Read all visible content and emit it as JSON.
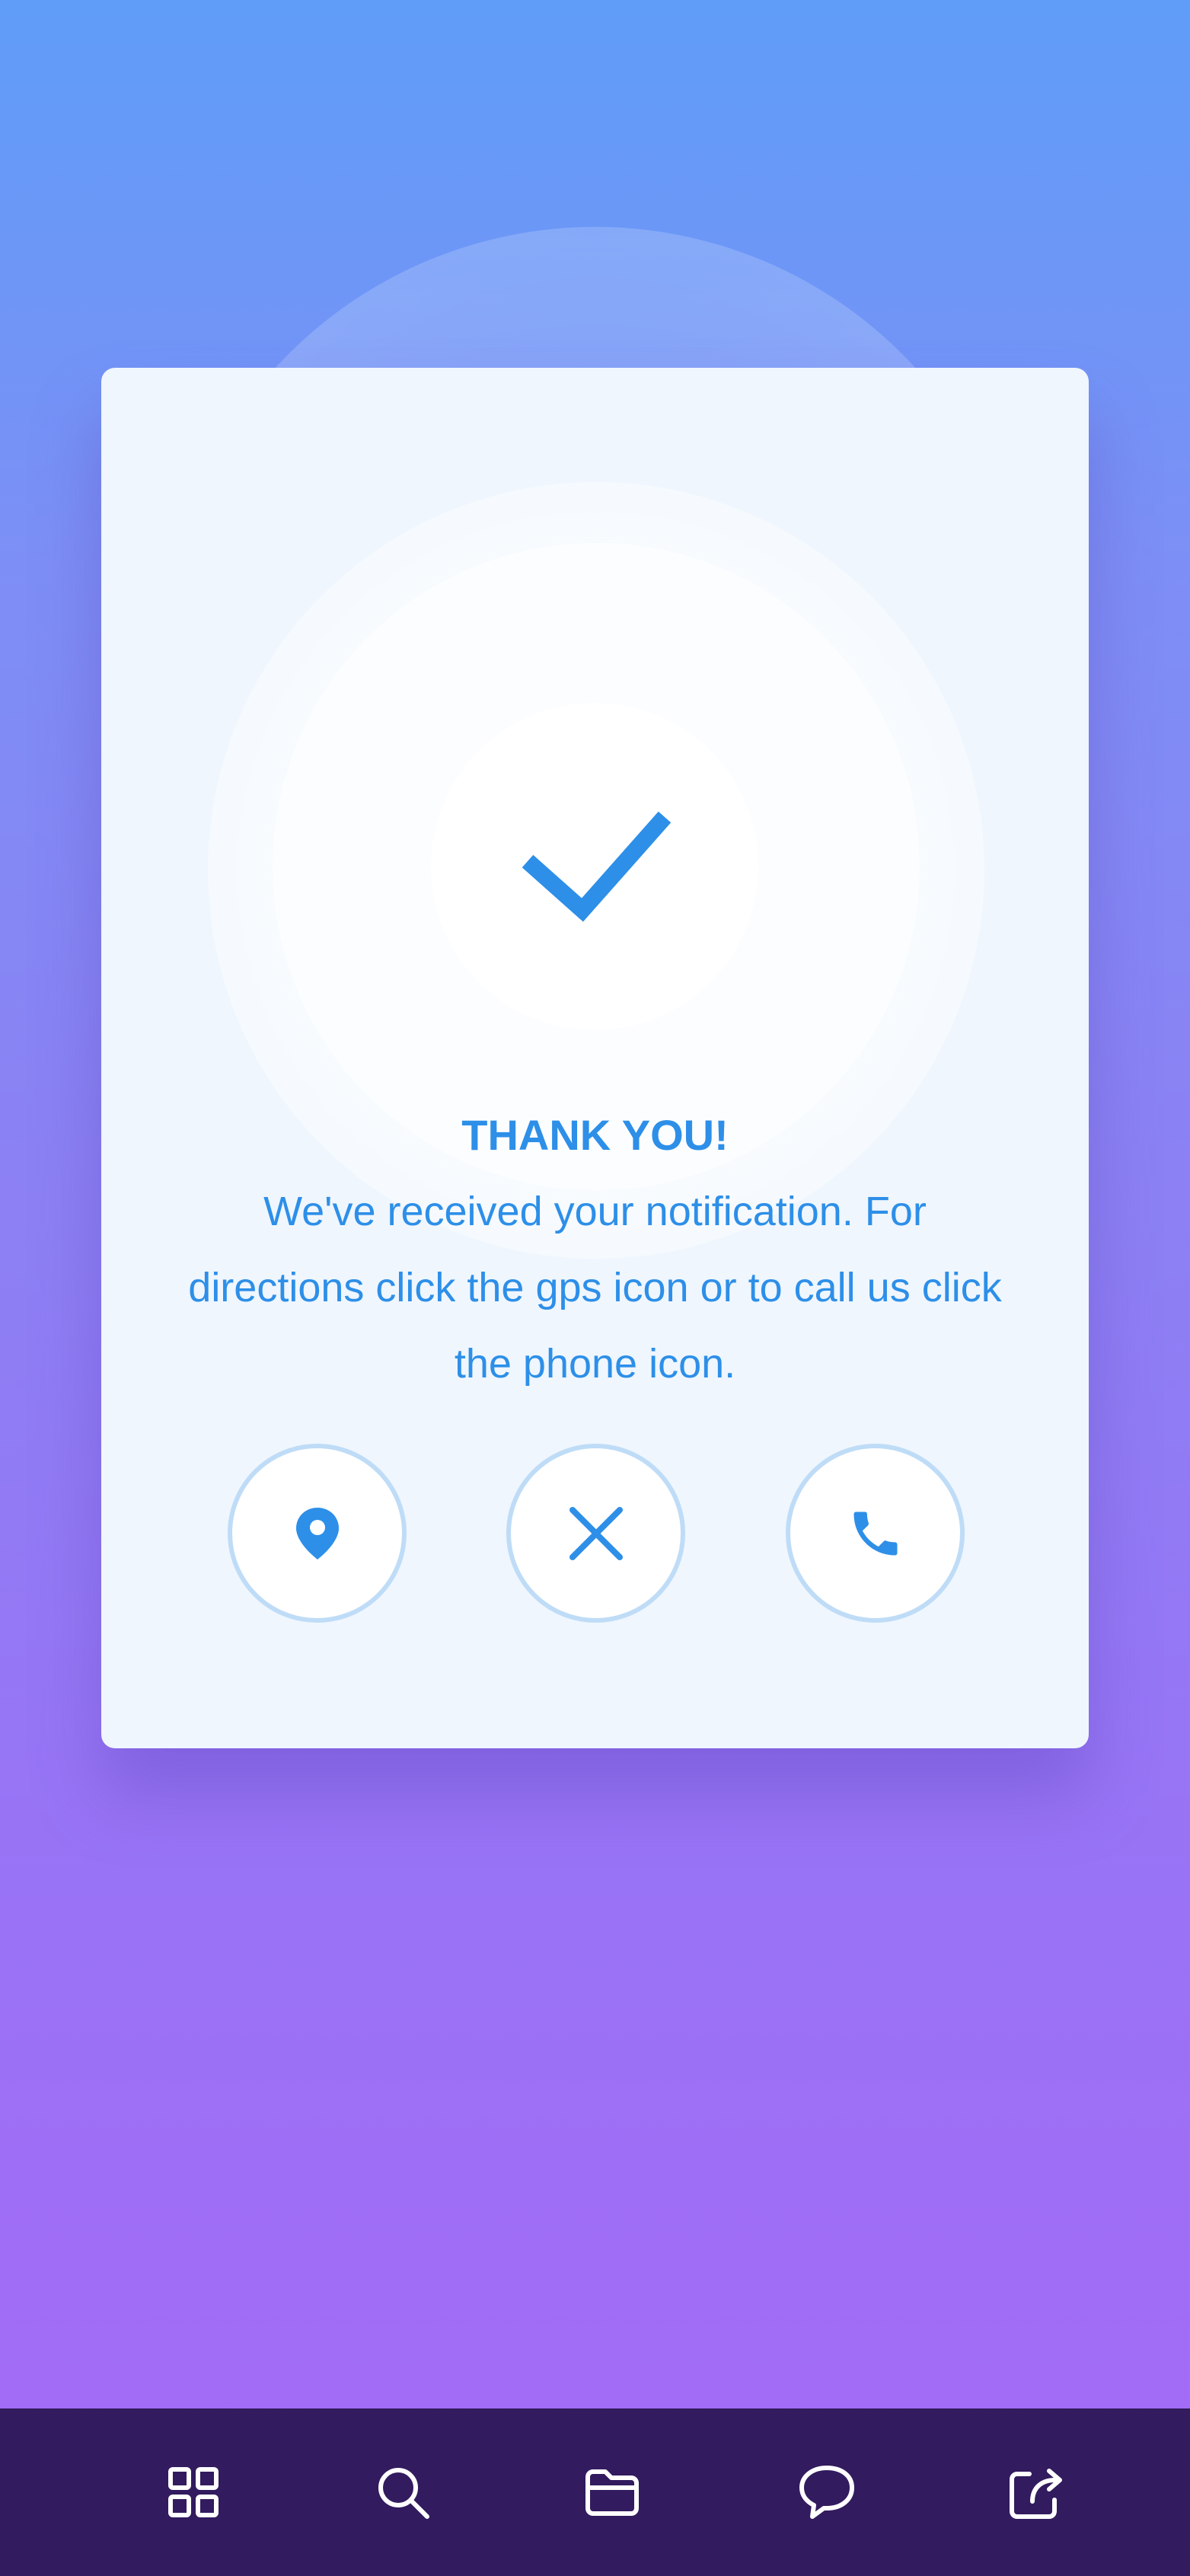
{
  "dialog": {
    "title": "THANK YOU!",
    "message": "We've received your notification. For directions click the gps icon or to call us click the phone icon.",
    "status_icon": "checkmark-icon"
  },
  "actions": [
    {
      "name": "gps-button",
      "icon": "map-pin-icon"
    },
    {
      "name": "close-button",
      "icon": "close-icon"
    },
    {
      "name": "phone-button",
      "icon": "phone-icon"
    }
  ],
  "bottom_nav": [
    {
      "name": "nav-apps",
      "icon": "grid-icon"
    },
    {
      "name": "nav-search",
      "icon": "search-icon"
    },
    {
      "name": "nav-folder",
      "icon": "folder-icon"
    },
    {
      "name": "nav-chat",
      "icon": "chat-bubble-icon"
    },
    {
      "name": "nav-share",
      "icon": "share-icon"
    }
  ],
  "colors": {
    "accent": "#2d8fe8",
    "card_background": "#eff6fe",
    "button_border": "#bfdcf7",
    "bottom_bar": "#321b5e",
    "gradient_top": "#5f9df8",
    "gradient_bottom": "#a569f6"
  }
}
